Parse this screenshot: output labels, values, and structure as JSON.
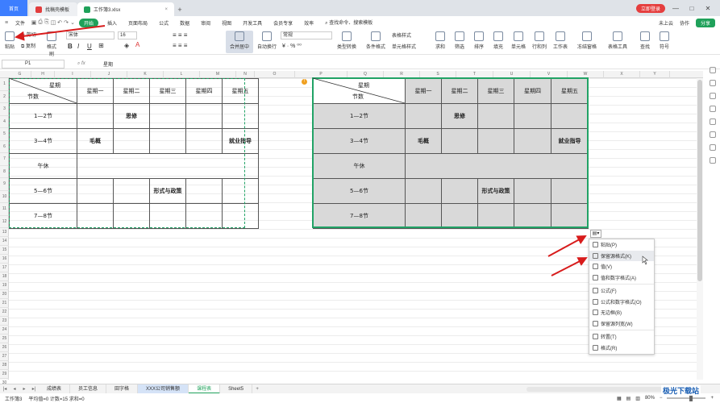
{
  "titlebar": {
    "home_label": "首页",
    "tab_template": "找稿壳模板",
    "tab_file": "工作簿3.xlsx",
    "new_tab": "+",
    "login_label": "立即登录",
    "min": "—",
    "max": "□",
    "close": "✕"
  },
  "menubar": {
    "file": "文件",
    "start": "开始",
    "items": [
      "插入",
      "页面布局",
      "公式",
      "数据",
      "审阅",
      "视图",
      "开发工具",
      "会员专享",
      "效率"
    ],
    "search": "查找命令、搜索模板",
    "unsynced": "未上云",
    "collab": "协作",
    "share": "分享"
  },
  "ribbon": {
    "paste": "粘贴",
    "cut": "剪切",
    "copy": "复制",
    "format_painter": "格式刷",
    "font": "宋体",
    "size": "16",
    "merge": "合并居中",
    "wrap": "自动换行",
    "number_format": "常规",
    "type_convert": "类型转换",
    "cond_format": "条件格式",
    "table_style": "表格样式",
    "cell_style": "单元格样式",
    "sum": "求和",
    "filter": "筛选",
    "sort": "排序",
    "fill": "填充",
    "cell": "单元格",
    "rowcol": "行和列",
    "sheet": "工作表",
    "freeze": "冻结窗格",
    "table_tools": "表格工具",
    "find": "查找",
    "symbol": "符号"
  },
  "formula": {
    "cell_ref": "P1",
    "fx": "fx",
    "value": "星期"
  },
  "columns": [
    "G",
    "H",
    "I",
    "J",
    "K",
    "L",
    "M",
    "N",
    "O",
    "P",
    "Q",
    "R",
    "S",
    "T",
    "U",
    "V",
    "W",
    "X",
    "Y"
  ],
  "rows": [
    "1",
    "2",
    "3",
    "4",
    "5",
    "6",
    "7",
    "8",
    "9",
    "10",
    "11",
    "12",
    "13",
    "14",
    "15",
    "16",
    "17",
    "18",
    "19",
    "20",
    "21",
    "22",
    "23",
    "24",
    "25",
    "26",
    "27",
    "28",
    "29",
    "30",
    "31",
    "32",
    "33",
    "34"
  ],
  "schedule": {
    "corner_top": "星期",
    "corner_bottom": "节数",
    "days": [
      "星期一",
      "星期二",
      "星期三",
      "星期四",
      "星期五"
    ],
    "r1": "1—2节",
    "r2": "3—4节",
    "r3": "午休",
    "r4": "5—6节",
    "r5": "7—8节",
    "c_r1_d2": "思修",
    "c_r2_d1": "毛概",
    "c_r2_d5": "就业指导",
    "c_r4_d3": "形式与政策"
  },
  "paste_menu": {
    "items": [
      "粘贴(P)",
      "保留源格式(K)",
      "值(V)",
      "值和数字格式(A)",
      "公式(F)",
      "公式和数字格式(O)",
      "无边框(B)",
      "保留源列宽(W)",
      "转置(T)",
      "格式(R)"
    ],
    "highlighted_index": 1
  },
  "sheets": [
    "成绩表",
    "员工信息",
    "田字格",
    "XXX公司销售额",
    "课程表",
    "Sheet5"
  ],
  "active_sheet": "课程表",
  "status": {
    "doc_helper": "工作簿3",
    "stats": "平均值=0  计数=15  求和=0",
    "zoom": "80%"
  },
  "watermark": "极光下载站",
  "colors": {
    "accent_green": "#21a366",
    "home_blue": "#3d7eff",
    "arrow_red": "#d81b1b"
  }
}
